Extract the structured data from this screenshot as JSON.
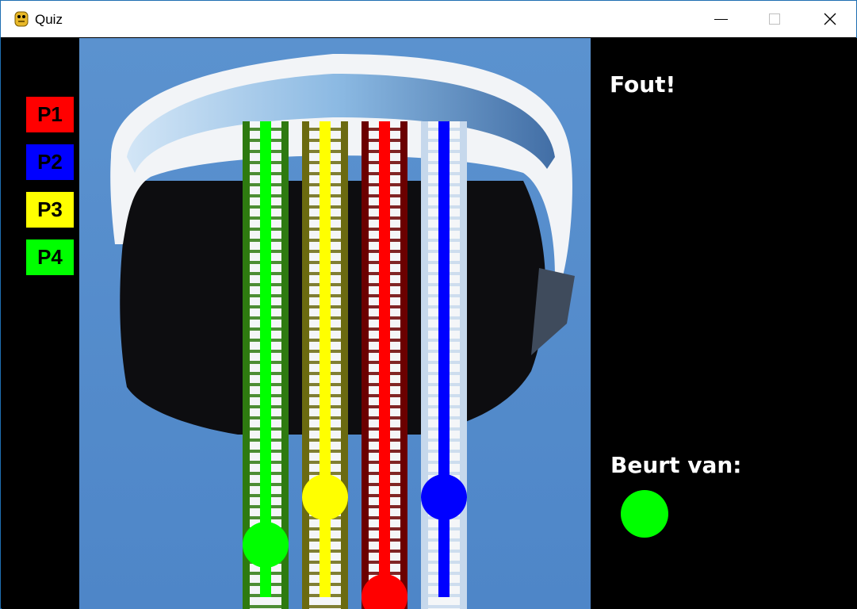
{
  "window": {
    "title": "Quiz",
    "icon": "python-snake-icon",
    "controls": [
      "minimize-icon",
      "maximize-icon",
      "close-icon"
    ]
  },
  "players": [
    {
      "label": "P1",
      "color": "#ff0000",
      "progress": 0.0
    },
    {
      "label": "P2",
      "color": "#0000ff",
      "progress": 0.21
    },
    {
      "label": "P3",
      "color": "#ffff00",
      "progress": 0.21
    },
    {
      "label": "P4",
      "color": "#00ff00",
      "progress": 0.11
    }
  ],
  "info": {
    "result": "Fout!",
    "turn_label": "Beurt van:",
    "turn_color": "#00ff00"
  },
  "colors": {
    "sky": "#4f86c6",
    "background": "#000000",
    "titlebar": "#ffffff"
  }
}
